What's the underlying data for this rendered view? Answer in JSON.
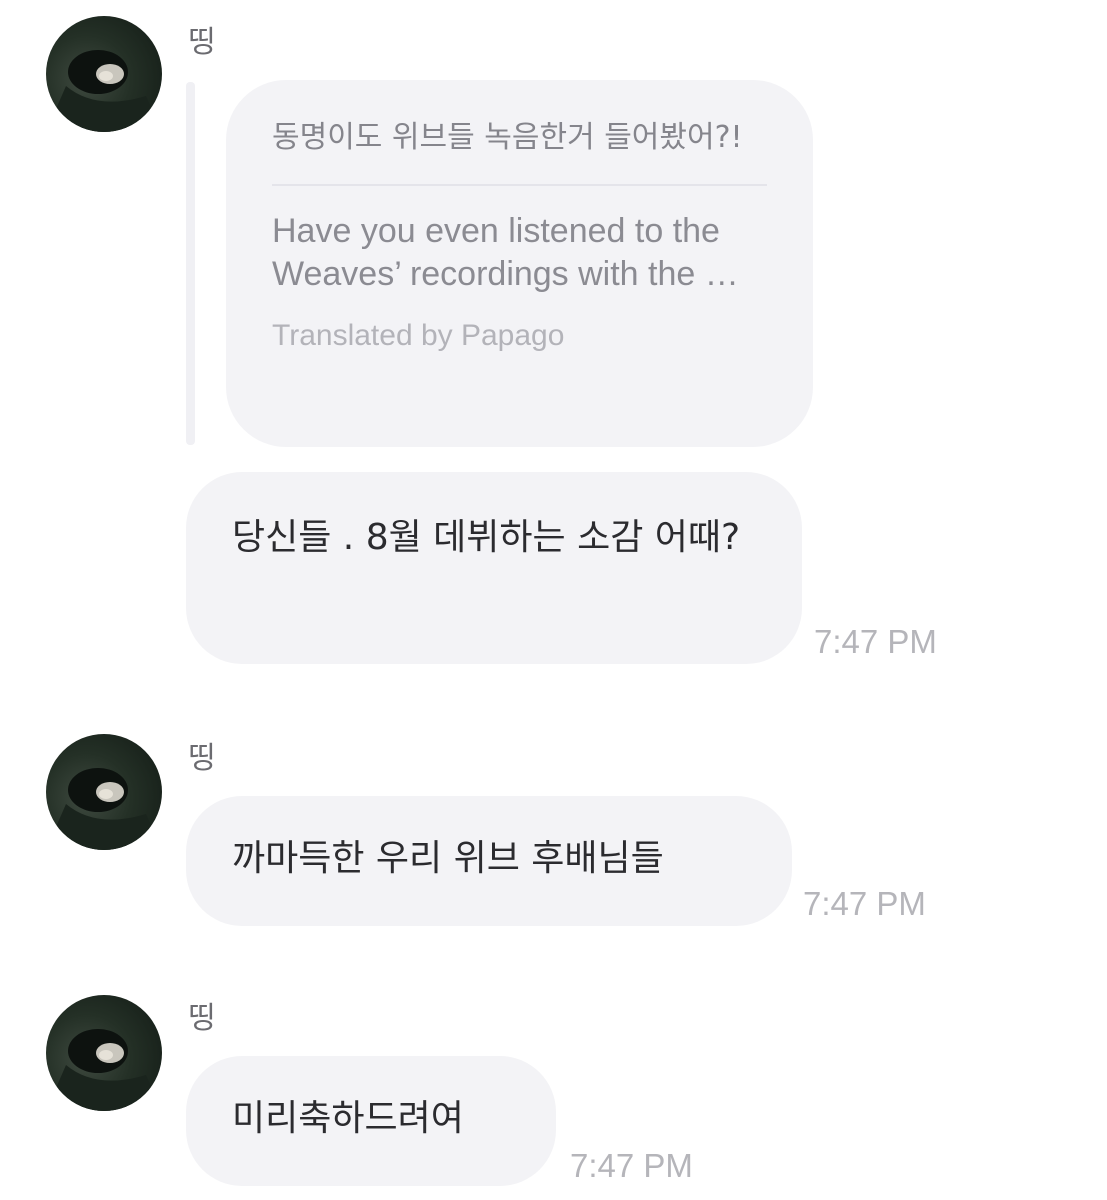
{
  "messages": [
    {
      "sender": "띵",
      "reply_quote": {
        "original": "동명이도 위브들 녹음한거 들어봤어?!",
        "translated": "Have you even listened to the Weaves’ recordings with the …",
        "credit": "Translated by Papago"
      },
      "text": "당신들 . 8월 데뷔하는 소감 어때?",
      "time": "7:47 PM"
    },
    {
      "sender": "띵",
      "text": "까마득한 우리 위브 후배님들",
      "time": "7:47 PM"
    },
    {
      "sender": "띵",
      "text": "미리축하드려여",
      "time": "7:47 PM"
    }
  ],
  "avatar_icon": "profile-photo"
}
